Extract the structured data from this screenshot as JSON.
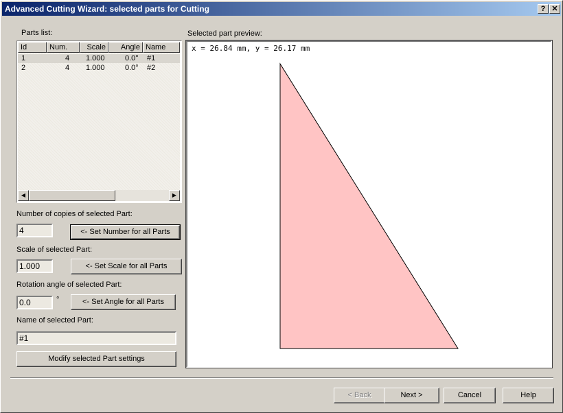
{
  "window": {
    "title": "Advanced Cutting Wizard: selected parts for Cutting",
    "help_button": "?",
    "close_button": "✕"
  },
  "parts_list": {
    "label": "Parts list:",
    "columns": [
      "Id",
      "Num.",
      "Scale",
      "Angle",
      "Name"
    ],
    "rows": [
      {
        "id": "1",
        "num": "4",
        "scale": "1.000",
        "angle": "0.0°",
        "name": "#1"
      },
      {
        "id": "2",
        "num": "4",
        "scale": "1.000",
        "angle": "0.0°",
        "name": "#2"
      }
    ],
    "scroll_left": "◀",
    "scroll_right": "▶"
  },
  "copies": {
    "label": "Number of copies of selected Part:",
    "value": "4",
    "button": "<- Set Number for all Parts"
  },
  "scale": {
    "label": "Scale of selected Part:",
    "value": "1.000",
    "button": "<- Set Scale for all Parts"
  },
  "rotation": {
    "label": "Rotation angle of selected Part:",
    "value": "0.0",
    "unit": "°",
    "button": "<- Set Angle for all Parts"
  },
  "name": {
    "label": "Name of selected Part:",
    "value": "#1"
  },
  "modify_button": "Modify selected Part settings",
  "preview": {
    "label": "Selected part preview:",
    "coords": "x = 26.84 mm, y = 26.17 mm",
    "shape_fill": "#ffc4c4"
  },
  "footer": {
    "back": "< Back",
    "next": "Next >",
    "cancel": "Cancel",
    "help": "Help"
  }
}
